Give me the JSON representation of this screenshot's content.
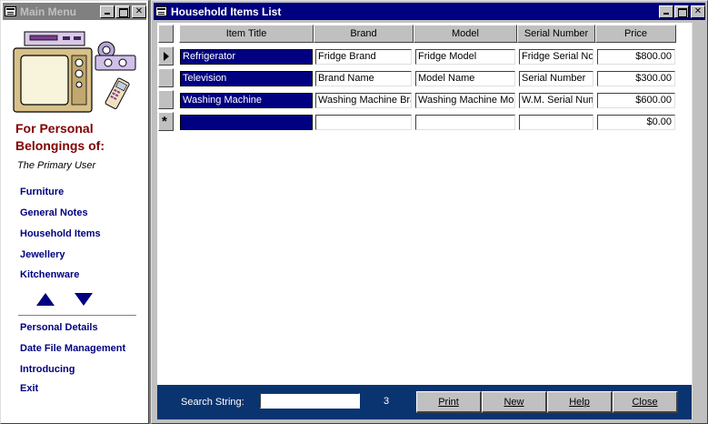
{
  "menu_window": {
    "title": "Main Menu",
    "owner_heading": "For Personal Belongings of:",
    "owner_name": "The Primary User",
    "nav": [
      "Furniture",
      "General Notes",
      "Household Items",
      "Jewellery",
      "Kitchenware"
    ],
    "nav_lower": [
      "Personal Details",
      "Date File Management",
      "Introducing",
      "Exit"
    ]
  },
  "list_window": {
    "title": "Household Items List",
    "columns": [
      "Item Title",
      "Brand",
      "Model",
      "Serial Number",
      "Price"
    ],
    "rows": [
      {
        "title": "Refrigerator",
        "brand": "Fridge Brand",
        "model": "Fridge Model",
        "serial": "Fridge Serial No",
        "price": "$800.00"
      },
      {
        "title": "Television",
        "brand": "Brand Name",
        "model": "Model Name",
        "serial": "Serial Number",
        "price": "$300.00"
      },
      {
        "title": "Washing Machine",
        "brand": "Washing Machine Bra",
        "model": "Washing Machine Mod",
        "serial": "W.M. Serial Numl",
        "price": "$600.00"
      }
    ],
    "new_row": {
      "title": "",
      "brand": "",
      "model": "",
      "serial": "",
      "price": "$0.00"
    },
    "footer": {
      "search_label": "Search String:",
      "search_value": "",
      "record_count": "3",
      "buttons": [
        "Print",
        "New",
        "Help",
        "Close"
      ]
    }
  },
  "colors": {
    "titlebar_active": "#000080",
    "titlebar_inactive": "#808080",
    "footer_bg": "#0a3470",
    "heading_red": "#800000",
    "link_blue": "#000080"
  },
  "icons": [
    "sysmenu-icon",
    "minimize-icon",
    "maximize-icon",
    "close-icon",
    "household-logo-icon",
    "scroll-up-icon",
    "scroll-down-icon",
    "current-row-icon",
    "new-row-icon"
  ]
}
